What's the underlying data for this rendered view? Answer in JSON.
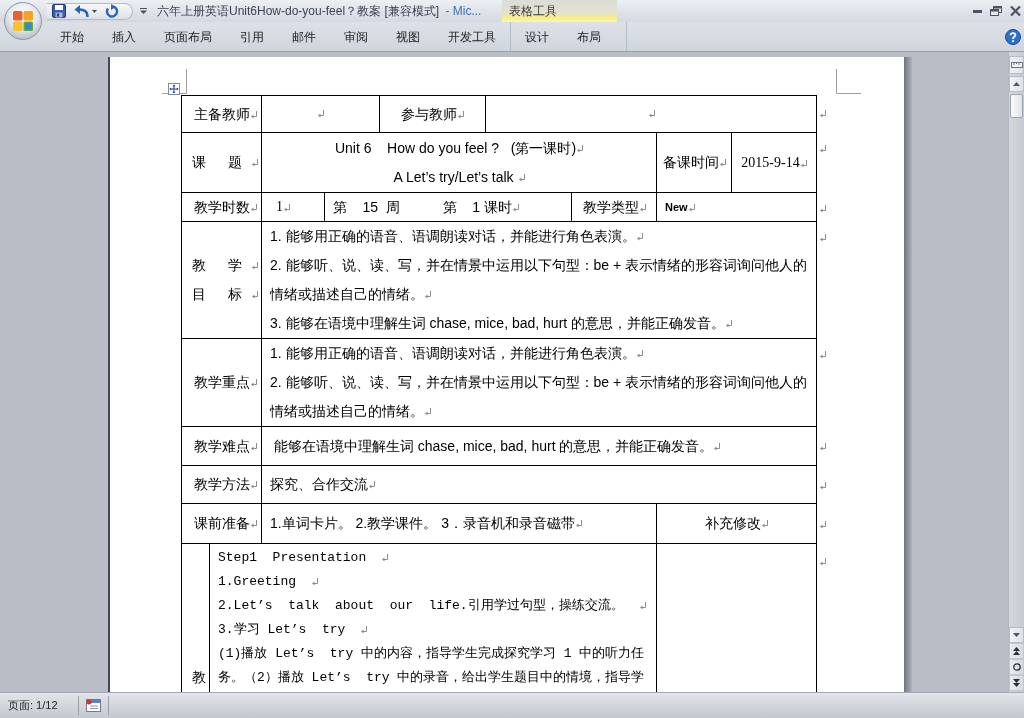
{
  "window": {
    "title": "六年上册英语Unit6How-do-you-feel？教案 [兼容模式]",
    "app_name": "- Mic..."
  },
  "ribbon": {
    "tabs": [
      {
        "label": "开始",
        "selected": false
      },
      {
        "label": "插入",
        "selected": false
      },
      {
        "label": "页面布局",
        "selected": false
      },
      {
        "label": "引用",
        "selected": false
      },
      {
        "label": "邮件",
        "selected": false
      },
      {
        "label": "审阅",
        "selected": false
      },
      {
        "label": "视图",
        "selected": false
      },
      {
        "label": "开发工具",
        "selected": false
      }
    ],
    "contextual_group": {
      "label": "表格工具",
      "tabs": [
        {
          "label": "设计",
          "selected": false
        },
        {
          "label": "布局",
          "selected": false
        }
      ]
    }
  },
  "formatting_marks": true,
  "table": {
    "rows": [
      {
        "cells": [
          {
            "kind": "center",
            "paragraphs": [
              "主备教师"
            ]
          },
          {
            "kind": "empty"
          },
          {
            "kind": "center",
            "paragraphs": [
              "参与教师"
            ]
          },
          {
            "kind": "empty"
          }
        ]
      },
      {
        "cells": [
          {
            "kind": "spread",
            "paragraphs": [
              "课 题"
            ]
          },
          {
            "kind": "center",
            "paragraphs": [
              "Unit 6    How do you feel ?   (第一课时)",
              "A Let’s try/Let’s talk "
            ]
          },
          {
            "kind": "center",
            "paragraphs": [
              "备课时间"
            ]
          },
          {
            "kind": "date",
            "paragraphs": [
              "2015-9-14"
            ]
          }
        ]
      },
      {
        "cells": [
          {
            "kind": "center",
            "paragraphs": [
              "教学时数"
            ]
          },
          {
            "kind": "number",
            "paragraphs": [
              "1"
            ]
          },
          {
            "kind": "left",
            "paragraphs": [
              "第    15  周           第    1 课时"
            ]
          },
          {
            "kind": "center",
            "paragraphs": [
              "教学类型"
            ]
          },
          {
            "kind": "code",
            "paragraphs": [
              "New"
            ]
          }
        ]
      },
      {
        "cells": [
          {
            "kind": "spread",
            "paragraphs": [
              "教 学",
              "目 标"
            ]
          },
          {
            "kind": "left",
            "paragraphs": [
              "1. 能够用正确的语音、语调朗读对话，并能进行角色表演。",
              "2. 能够听、说、读、写，并在情景中运用以下句型：be + 表示情绪的形容词询问他人的情绪或描述自己的情绪。",
              "3. 能够在语境中理解生词 chase, mice, bad, hurt 的意思，并能正确发音。"
            ]
          }
        ]
      },
      {
        "cells": [
          {
            "kind": "center",
            "paragraphs": [
              "教学重点"
            ]
          },
          {
            "kind": "left",
            "paragraphs": [
              "1. 能够用正确的语音、语调朗读对话，并能进行角色表演。",
              "2. 能够听、说、读、写，并在情景中运用以下句型：be + 表示情绪的形容词询问他人的情绪或描述自己的情绪。"
            ]
          }
        ]
      },
      {
        "cells": [
          {
            "kind": "center",
            "paragraphs": [
              "教学难点"
            ]
          },
          {
            "kind": "left",
            "paragraphs": [
              " 能够在语境中理解生词 chase, mice, bad, hurt 的意思，并能正确发音。"
            ]
          }
        ]
      },
      {
        "cells": [
          {
            "kind": "center",
            "paragraphs": [
              "教学方法"
            ]
          },
          {
            "kind": "left",
            "paragraphs": [
              "探究、合作交流"
            ]
          }
        ]
      },
      {
        "cells": [
          {
            "kind": "center",
            "paragraphs": [
              "课前准备"
            ]
          },
          {
            "kind": "left",
            "paragraphs": [
              "1.单词卡片。 2.教学课件。 3．录音机和录音磁带"
            ]
          },
          {
            "kind": "center",
            "paragraphs": [
              "补充修改"
            ]
          }
        ]
      },
      {
        "cells": [
          {
            "kind": "vertical",
            "paragraphs": [
              "教"
            ]
          },
          {
            "kind": "mono",
            "paragraphs": [
              "Step1  Presentation",
              "1.Greeting",
              "2.Let’s  talk  about  our  life.引用学过句型，操练交流。",
              "3.学习 Let’s  try",
              "(1)播放 Let’s  try 中的内容，指导学生完成探究学习 1 中的听力任务。（2）播放 Let’s  try 中的录音，给出学生题目中的情境，指导学"
            ]
          },
          {
            "kind": "blank"
          }
        ]
      }
    ]
  },
  "status_bar": {
    "page": "页面: 1/12"
  }
}
